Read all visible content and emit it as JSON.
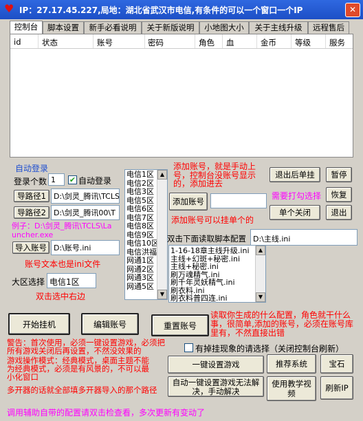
{
  "window": {
    "title": "IP：27.17.45.227,局地：湖北省武汉市电信,有条件的可以一个窗口一个IP",
    "close_label": "✕"
  },
  "tabs": [
    {
      "label": "控制台"
    },
    {
      "label": "脚本设置"
    },
    {
      "label": "新手必看说明"
    },
    {
      "label": "关于新版说明"
    },
    {
      "label": "小地图大小"
    },
    {
      "label": "关于主线升级"
    },
    {
      "label": "远程售后"
    }
  ],
  "table": {
    "columns": [
      "id",
      "状态",
      "账号",
      "密码",
      "角色",
      "血",
      "金币",
      "等级",
      "服务"
    ]
  },
  "auto_login": {
    "group_label": "自动登录",
    "count_label": "登录个数",
    "count_value": "1",
    "auto_login_label": "自动登录",
    "auto_login_checked": true,
    "path1_button": "导路径1",
    "path1_value": "D:\\剑灵_腾讯\\TCLS",
    "path2_button": "导路径2",
    "path2_value": "D:\\剑灵_腾讯00\\T",
    "example_text": "例子：D:\\剑灵_腾讯\\TCLS\\Launcher.exe",
    "import_button": "导入账号",
    "import_value": "D:\\账号.ini",
    "account_note": "账号文本也是ini文件",
    "region_label": "大区选择",
    "region_value": "电信1区",
    "region_note": "双击选中右边"
  },
  "server_list": {
    "items": [
      "电信1区",
      "电信2区",
      "电信3区",
      "电信5区",
      "电信6区",
      "电信7区",
      "电信8区",
      "电信9区",
      "电信10区",
      "电信洪福",
      "网通1区",
      "网通2区",
      "网通3区",
      "网通5区"
    ]
  },
  "middle": {
    "add_note": "添加账号，就是手动上号，控制台没账号显示的，添加进去",
    "add_button": "添加账号",
    "add_input": "",
    "single_note": "添加账号可以挂单个的",
    "config_note": "双击下面读取脚本配置",
    "config_path": "D:\\主线.ini",
    "config_items": [
      "1-16-18章主线升级.ini",
      "主线+幻斑+秘密.ini",
      "主线+秘密.ini",
      "刷万魂精气.ini",
      "刷千年灵妖精气.ini",
      "刷衣料.ini",
      "刷衣料普四连.ini"
    ]
  },
  "right_panel": {
    "logout_button": "退出后单挂",
    "pause_button": "暂停",
    "punch_note": "需要打勾选择",
    "resume_button": "恢复",
    "single_close_button": "单个关闭",
    "exit_button": "退出"
  },
  "actions": {
    "start_button": "开始挂机",
    "edit_button": "编辑账号",
    "reset_button": "重置账号",
    "read_note": "读取你生成的什么配置，角色就干什么事，很简单,添加的账号，必须在账号库里有，不然直接出错"
  },
  "notes": {
    "warning": "警告：首次使用，必须一键设置游戏，必须把所有游戏关闭后再设置，不然没效果的",
    "mode": "游戏操作模式：经典模式，桌面主题不能为经典模式，必须是有风景的，不可以最小化窗口",
    "multi": "多开器的话就全部填多开器导入的那个路径",
    "bottom": "调用辅助自带的配置请双击检查看，多次更新有变动了"
  },
  "options": {
    "hang_label": "有掉挂现象的请选择（关闭控制台刷新）",
    "hang_checked": false
  },
  "bottom_buttons": {
    "one_key": "一键设置游戏",
    "recommend": "推荐系统",
    "gem": "宝石",
    "manual": "自动一键设置游戏无法解决，手动解决",
    "video": "使用教学视频",
    "refresh_ip": "刷新IP"
  },
  "colors": {
    "title_bg": "#2457d6",
    "note_red": "#ff0000",
    "note_blue": "#1f4fd0",
    "note_pink": "#ff00ff"
  }
}
